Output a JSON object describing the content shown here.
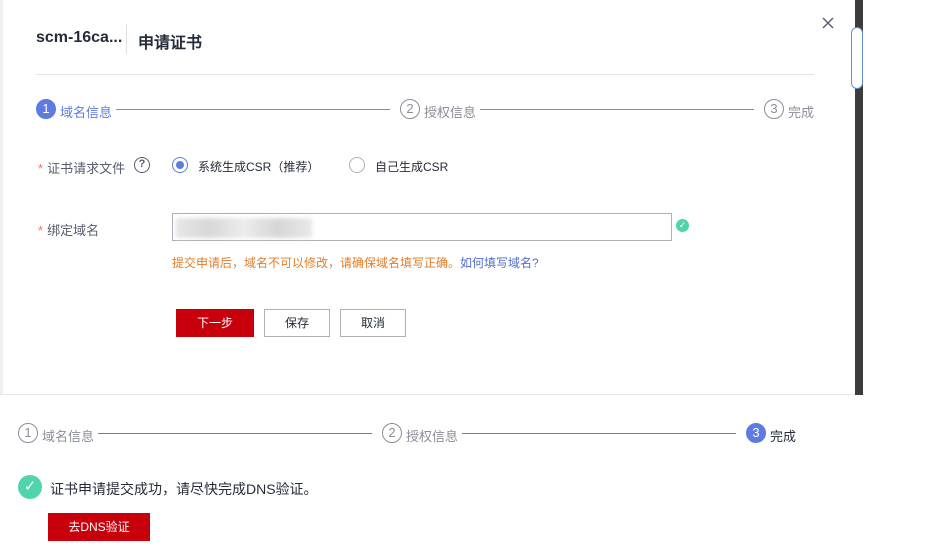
{
  "dialog": {
    "id_text": "scm-16ca...",
    "title": "申请证书"
  },
  "steps_top": [
    {
      "num": "1",
      "label": "域名信息"
    },
    {
      "num": "2",
      "label": "授权信息"
    },
    {
      "num": "3",
      "label": "完成"
    }
  ],
  "form": {
    "csr_label": "证书请求文件",
    "required_mark": "*",
    "help_glyph": "?",
    "csr_options": [
      "系统生成CSR（推荐）",
      "自己生成CSR"
    ],
    "domain_label": "绑定域名",
    "domain_value": "",
    "hint_text": "提交申请后，域名不可以修改，请确保域名填写正确。",
    "hint_link": "如何填写域名?"
  },
  "buttons": {
    "next": "下一步",
    "save": "保存",
    "cancel": "取消"
  },
  "steps_bottom": [
    {
      "num": "1",
      "label": "域名信息"
    },
    {
      "num": "2",
      "label": "授权信息"
    },
    {
      "num": "3",
      "label": "完成"
    }
  ],
  "result": {
    "success_text": "证书申请提交成功，请尽快完成DNS验证。",
    "dns_button": "去DNS验证"
  },
  "colors": {
    "accent": "#5e7ce0",
    "primary_button": "#c7000b",
    "success": "#50d4ab",
    "warning_text": "#e37d29"
  }
}
